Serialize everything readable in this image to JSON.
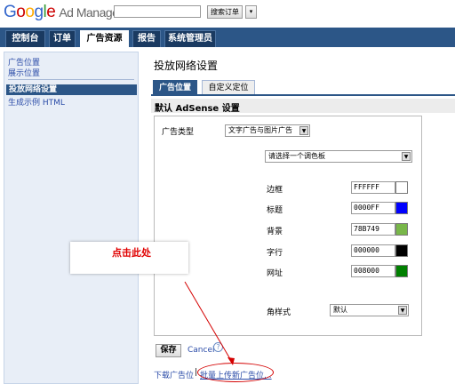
{
  "header": {
    "logo_google": "Google",
    "product": "Ad Manager",
    "search_value": "",
    "search_button": "搜索订单",
    "search_dropdown": "▾"
  },
  "nav": {
    "tabs": [
      {
        "label": "控制台"
      },
      {
        "label": "订单"
      },
      {
        "label": "广告资源"
      },
      {
        "label": "报告"
      },
      {
        "label": "系统管理员"
      }
    ],
    "active_index": 2
  },
  "sidebar": {
    "items": [
      {
        "label": "广告位置"
      },
      {
        "label": "展示位置"
      },
      {
        "label": "投放网络设置"
      },
      {
        "label": "生成示例 HTML"
      }
    ],
    "active_index": 2
  },
  "main": {
    "title": "投放网络设置",
    "subtabs": [
      {
        "label": "广告位置"
      },
      {
        "label": "自定义定位"
      }
    ],
    "section_title": "默认 AdSense 设置",
    "ad_type_label": "广告类型",
    "ad_type_value": "文字广告与图片广告",
    "palette_value": "请选择一个调色板",
    "colors": [
      {
        "label": "边框",
        "value": "FFFFFF",
        "color": "#FFFFFF"
      },
      {
        "label": "标题",
        "value": "0000FF",
        "color": "#0000FF"
      },
      {
        "label": "背景",
        "value": "78B749",
        "color": "#78B749"
      },
      {
        "label": "字行",
        "value": "000000",
        "color": "#000000"
      },
      {
        "label": "网址",
        "value": "008000",
        "color": "#008000"
      }
    ],
    "corner_label": "角样式",
    "corner_value": "默认",
    "save_label": "保存",
    "cancel_label": "Cancel",
    "help_icon": "?",
    "download_label": "下载广告位",
    "separator": "|",
    "upload_label": "批量上传新广告位..."
  },
  "annotation": {
    "text": "点击此处",
    "color": "#E00000"
  }
}
